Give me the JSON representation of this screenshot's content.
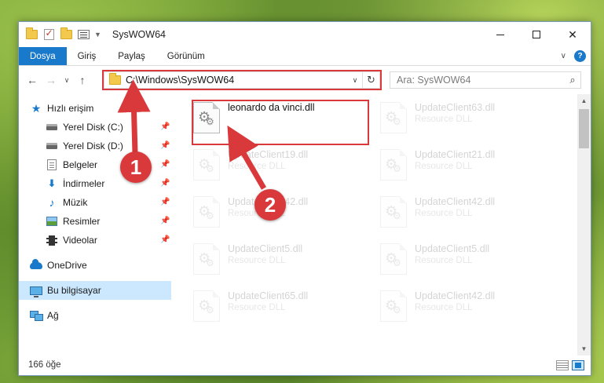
{
  "window": {
    "title": "SysWOW64"
  },
  "ribbon": {
    "tabs": [
      "Dosya",
      "Giriş",
      "Paylaş",
      "Görünüm"
    ],
    "help_label": "?"
  },
  "nav": {
    "address": "C:\\Windows\\SysWOW64",
    "search_placeholder": "Ara: SysWOW64"
  },
  "sidebar": {
    "quick_access": "Hızlı erişim",
    "items": [
      {
        "label": "Yerel Disk (C:)",
        "icon": "disk-icon"
      },
      {
        "label": "Yerel Disk (D:)",
        "icon": "disk-icon"
      },
      {
        "label": "Belgeler",
        "icon": "document-icon"
      },
      {
        "label": "İndirmeler",
        "icon": "download-icon"
      },
      {
        "label": "Müzik",
        "icon": "music-icon"
      },
      {
        "label": "Resimler",
        "icon": "pictures-icon"
      },
      {
        "label": "Videolar",
        "icon": "video-icon"
      }
    ],
    "onedrive": "OneDrive",
    "this_pc": "Bu bilgisayar",
    "network": "Ağ"
  },
  "files": {
    "highlighted": {
      "name": "leonardo da vinci.dll",
      "type": ""
    },
    "items": [
      {
        "name": "UpdateClient63.dll",
        "type": "Resource DLL"
      },
      {
        "name": "UpdateClient19.dll",
        "type": "Resource DLL"
      },
      {
        "name": "UpdateClient21.dll",
        "type": "Resource DLL"
      },
      {
        "name": "UpdateClient42.dll",
        "type": "Resource DLL"
      },
      {
        "name": "UpdateClient42.dll",
        "type": "Resource DLL"
      },
      {
        "name": "UpdateClient5.dll",
        "type": "Resource DLL"
      },
      {
        "name": "UpdateClient5.dll",
        "type": "Resource DLL"
      },
      {
        "name": "UpdateClient65.dll",
        "type": "Resource DLL"
      },
      {
        "name": "UpdateClient42.dll",
        "type": "Resource DLL"
      }
    ]
  },
  "status": {
    "count": "166 öğe"
  },
  "annotations": {
    "step1": "1",
    "step2": "2",
    "accent": "#d9393a"
  }
}
